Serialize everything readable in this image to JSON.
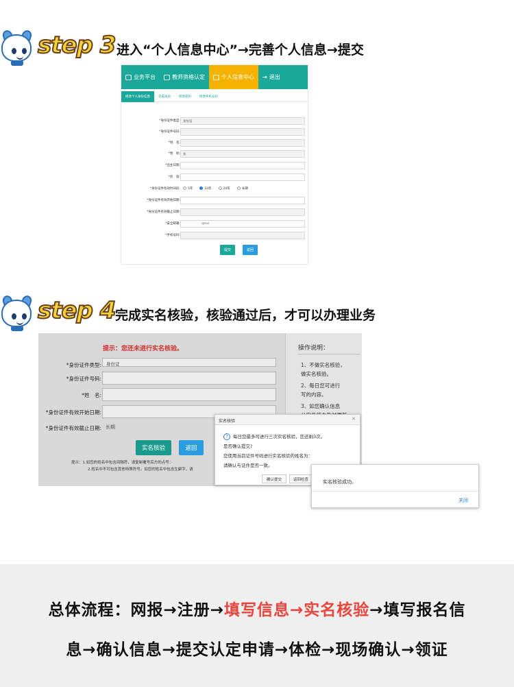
{
  "step3": {
    "word": "step 3",
    "desc": "进入“个人信息中心”→完善个人信息→提交",
    "nav": [
      "业务平台",
      "教师资格认定",
      "个人信息中心",
      "退出"
    ],
    "tabs": [
      "修改个人身份信息",
      "实名核验",
      "修改密码",
      "修改手机号码"
    ],
    "fields": [
      {
        "label": "*身份证件类型:",
        "value": "身份证"
      },
      {
        "label": "*身份证件号码:",
        "value": ""
      },
      {
        "label": "*姓　名:",
        "value": ""
      },
      {
        "label": "*性　别:",
        "value": "女"
      },
      {
        "label": "*出生日期:",
        "value": ""
      },
      {
        "label": "*民　族:",
        "value": ""
      },
      {
        "label": "*身份证件有效时间段:",
        "value": ""
      },
      {
        "label": "*身份证件有效开始日期:",
        "value": ""
      },
      {
        "label": "*身份证件有效截止日期:",
        "value": ""
      },
      {
        "label": "*安全邮箱:",
        "value": "qmai"
      },
      {
        "label": "*手机号码:",
        "value": ""
      }
    ],
    "validity_options": [
      "5年",
      "10年",
      "20年",
      "长期"
    ],
    "submit_label": "提交",
    "back_label": "返回"
  },
  "step4": {
    "word": "step 4",
    "desc": "完成实名核验，核验通过后，才可以办理业务",
    "warning": "提示：您还未进行实名核验。",
    "fields": [
      {
        "label": "*身份证件类型:",
        "value": "身份证"
      },
      {
        "label": "*身份证件号码:",
        "value": ""
      },
      {
        "label": "*姓　名:",
        "value": ""
      },
      {
        "label": "*身份证件有效开始日期:",
        "value": ""
      },
      {
        "label": "*身份证件有效截止日期:",
        "value": "长期"
      }
    ],
    "verify_label": "实名核验",
    "back_label": "返回",
    "note1": "提示：1.如您的姓名中包含间隔符，请复制署号后方的点号：·",
    "note2": "2.姓名中不可包含其他特殊符号。如您的姓名中包含生僻字，请",
    "side_title": "操作说明：",
    "side_items": [
      "1、不做实名核验，\n做实名核验。",
      "2、每日您可进行\n写的内容。",
      "3、如您确认信息\n公安系统未及时更新"
    ],
    "dialog1": {
      "title": "实名核验",
      "line1": "每日您最多可进行三次实名核验，您还剩3次。",
      "line2": "是否确认提交?",
      "line3": "您使用当前证件号码进行实名核验的姓名为：",
      "line4": "请确认与证件是否一致。",
      "confirm": "确认提交",
      "back": "返回检查"
    },
    "dialog2": {
      "message": "实名核验成功。",
      "close": "关闭"
    }
  },
  "footer": {
    "line1_prefix": "总体流程：网报→注册→",
    "line1_highlight": "填写信息→实名核验",
    "line1_suffix": "→填写报名信",
    "line2": "息→确认信息→提交认定申请→体检→现场确认→领证"
  },
  "colors": {
    "teal": "#1aa89a",
    "orange": "#f5b300",
    "blue": "#2a7de1",
    "red": "#e8453c",
    "step_yellow": "#f4d23a"
  }
}
